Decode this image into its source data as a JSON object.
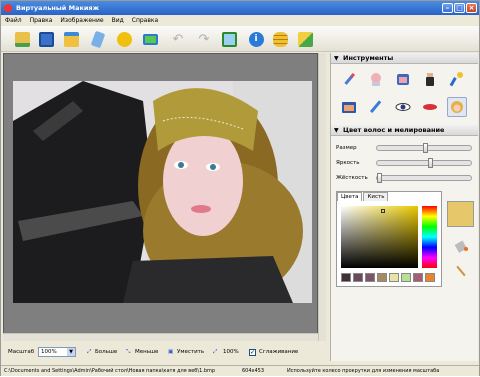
{
  "window": {
    "title": "Виртуальный Макияж"
  },
  "menu": [
    "Файл",
    "Правка",
    "Изображение",
    "Вид",
    "Справка"
  ],
  "toolbar_icons": [
    "open-icon",
    "save-icon",
    "folder-icon",
    "brush-icon",
    "smiley-icon",
    "monitor-icon",
    "undo-icon",
    "redo-icon",
    "export-icon",
    "info-icon",
    "coins-icon",
    "cube-icon"
  ],
  "panel": {
    "title": "Инструменты",
    "tool_icons": [
      "lipstick-icon",
      "face-mask-icon",
      "powder-icon",
      "bottle-icon",
      "brush-spray-icon",
      "eyeshadow-icon",
      "pencil-icon",
      "eye-icon",
      "lips-icon",
      "hair-icon"
    ],
    "section_title": "Цвет волос и мелирование",
    "sliders": [
      {
        "label": "Размер",
        "value": 0.52
      },
      {
        "label": "Яркость",
        "value": 0.57
      },
      {
        "label": "Жёсткость",
        "value": 0.0
      }
    ],
    "tabs": [
      "Цвета",
      "Кисть"
    ],
    "swatches": [
      "#403038",
      "#6a4a5c",
      "#7c5464",
      "#a88a62",
      "#e6e4a6",
      "#b8e092",
      "#a85c70",
      "#e8842c"
    ],
    "current_color": "#e6c86a"
  },
  "bottom": {
    "zoom_label": "Масштаб",
    "zoom_value": "100%",
    "bigger": "Больше",
    "smaller": "Меньше",
    "fit": "Уместить",
    "hundred": "100%",
    "smooth": "Сглаживание"
  },
  "status": {
    "path": "C:\\Documents and Settings\\Admin\\Рабочий стол\\Новая папка\\катя для веб\\1.bmp",
    "size": "604x453",
    "hint": "Используйте колесо прокрутки для изменения масштаба"
  }
}
